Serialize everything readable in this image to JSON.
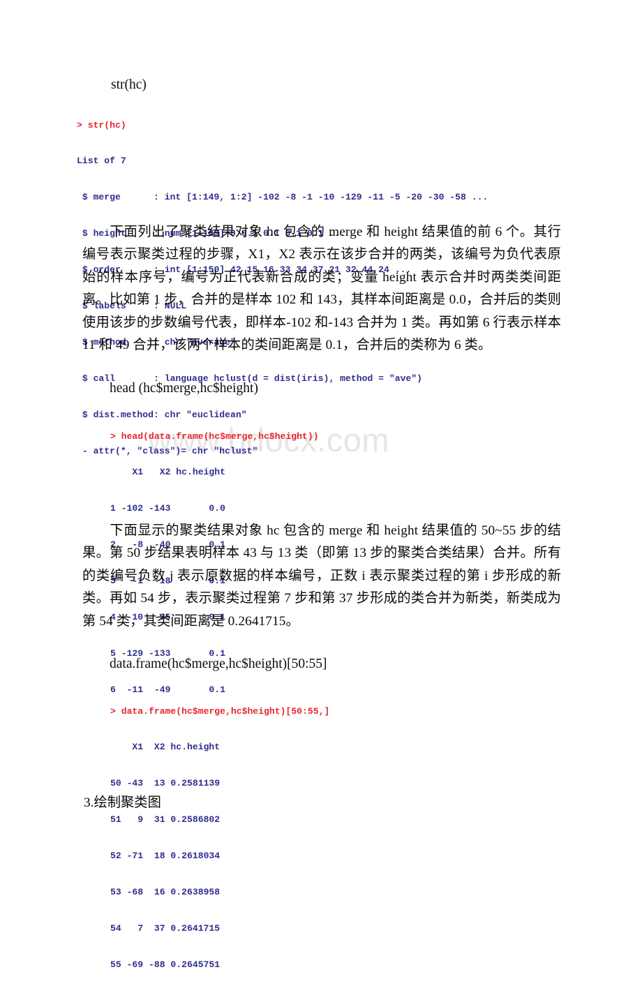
{
  "watermark": {
    "text": "www.bdocx.com",
    "color": "#e6e6e6"
  },
  "colors": {
    "prompt": "#e8262b",
    "console_output": "#2f2f8f",
    "body_text": "#0a0a0a",
    "page_background": "#ffffff"
  },
  "headings": {
    "str_hc": "str(hc)",
    "head_merge_height": "head (hc$merge,hc$height)",
    "data_frame_slice": "data.frame(hc$merge,hc$height)[50:55]"
  },
  "console_blocks": {
    "str_output": {
      "command": "> str(hc)",
      "lines": [
        "List of 7",
        " $ merge      : int [1:149, 1:2] -102 -8 -1 -10 -129 -11 -5 -20 -30 -58 ...",
        " $ height     : num [1:149] 0 0.1 0.1 0.1 0.1 ...",
        " $ order      : int [1:150] 42 15 16 33 34 37 21 32 44 24 ...",
        " $ labels     : NULL",
        " $ method     : chr \"average\"",
        " $ call       : language hclust(d = dist(iris), method = \"ave\")",
        " $ dist.method: chr \"euclidean\"",
        " - attr(*, \"class\")= chr \"hclust\""
      ]
    },
    "head_output": {
      "command": "> head(data.frame(hc$merge,hc$height))",
      "lines": [
        "    X1   X2 hc.height",
        "1 -102 -143       0.0",
        "2   -8  -40       0.1",
        "3   -1  -18       0.1",
        "4  -10  -35       0.1",
        "5 -129 -133       0.1",
        "6  -11  -49       0.1"
      ]
    },
    "slice_output": {
      "command": "> data.frame(hc$merge,hc$height)[50:55,]",
      "lines": [
        "    X1  X2 hc.height",
        "50 -43  13 0.2581139",
        "51   9  31 0.2586802",
        "52 -71  18 0.2618034",
        "53 -68  16 0.2638958",
        "54   7  37 0.2641715",
        "55 -69 -88 0.2645751"
      ]
    }
  },
  "paragraphs": {
    "first": "下面列出了聚类结果对象 hc 包含的 merge 和 height 结果值的前 6 个。其行编号表示聚类过程的步骤，X1，X2 表示在该步合并的两类，该编号为负代表原始的样本序号，编号为正代表新合成的类；变量 height 表示合并时两类类间距离。比如第 1 步，合并的是样本 102 和 143，其样本间距离是 0.0，合并后的类则使用该步的步数编号代表，即样本-102 和-143 合并为 1 类。再如第 6 行表示样本 11 和 49 合并，该两个样本的类间距离是 0.1，合并后的类称为 6 类。",
    "second": "下面显示的聚类结果对象 hc 包含的 merge 和 height 结果值的 50~55 步的结果。第 50 步结果表明样本 43 与 13 类（即第 13 步的聚类合类结果）合并。所有的类编号负数 j 表示原数据的样本编号，正数 i 表示聚类过程的第 i 步形成的新类。再如 54 步，表示聚类过程第 7 步和第 37 步形成的类合并为新类，新类成为第 54 类，其类间距离是 0.2641715。"
  },
  "section_heading": "3.绘制聚类图"
}
